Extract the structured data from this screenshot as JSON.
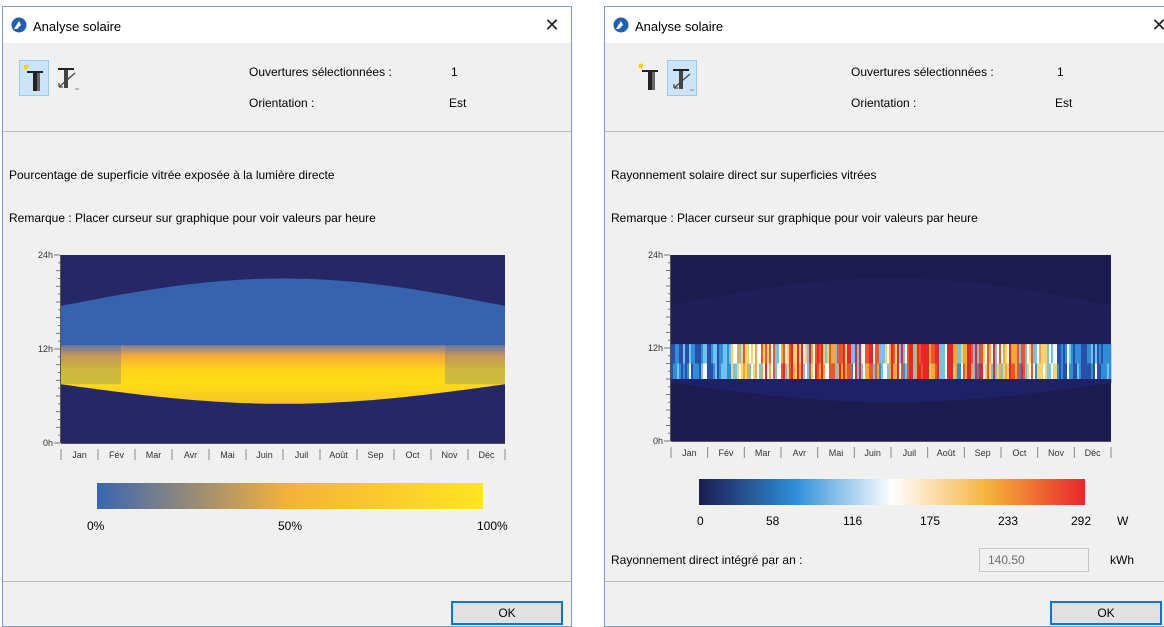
{
  "dialog_left": {
    "title": "Analyse solaire",
    "close_glyph": "✕",
    "info": {
      "openings_label": "Ouvertures sélectionnées :",
      "openings_value": "1",
      "orientation_label": "Orientation :",
      "orientation_value": "Est"
    },
    "tools": [
      {
        "icon": "shading-percentage-icon",
        "selected": true
      },
      {
        "icon": "solar-radiation-icon",
        "selected": false
      }
    ],
    "heading": "Pourcentage de superficie vitrée exposée à la lumière directe",
    "remark": "Remarque : Placer curseur sur graphique pour voir valeurs par heure",
    "legend": {
      "labels": [
        "0%",
        "50%",
        "100%"
      ],
      "colors": [
        "#3a66b0",
        "#f5b23a",
        "#ffe520"
      ]
    },
    "ok_label": "OK"
  },
  "dialog_right": {
    "title": "Analyse solaire",
    "close_glyph": "✕",
    "info": {
      "openings_label": "Ouvertures sélectionnées :",
      "openings_value": "1",
      "orientation_label": "Orientation :",
      "orientation_value": "Est"
    },
    "tools": [
      {
        "icon": "shading-percentage-icon",
        "selected": false
      },
      {
        "icon": "solar-radiation-icon",
        "selected": true
      }
    ],
    "heading": "Rayonnement solaire direct sur superficies vitrées",
    "remark": "Remarque : Placer curseur sur graphique pour voir valeurs par heure",
    "legend": {
      "labels": [
        "0",
        "58",
        "116",
        "175",
        "233",
        "292"
      ],
      "unit": "W",
      "colors": [
        "#1c1b50",
        "#2e8fd8",
        "#ffffff",
        "#f5b23a",
        "#e8262a"
      ]
    },
    "annual_label": "Rayonnement direct intégré par an :",
    "annual_value": "140.50",
    "annual_unit": "kWh",
    "ok_label": "OK"
  },
  "chart_data": [
    {
      "type": "heatmap",
      "title": "Pourcentage de superficie vitrée exposée à la lumière directe",
      "x_categories": [
        "Jan",
        "Fév",
        "Mar",
        "Avr",
        "Mai",
        "Juin",
        "Juil",
        "Août",
        "Sep",
        "Oct",
        "Nov",
        "Déc"
      ],
      "y_ticks": [
        "24h",
        "12h",
        "0h"
      ],
      "y_range_hours": [
        0,
        24
      ],
      "value_range_percent": [
        0,
        100
      ],
      "bands_hours": [
        {
          "value": "night",
          "from_hours": 0,
          "to_hours": 7.5
        },
        {
          "value": "direct light",
          "from_hours": 7.5,
          "to_hours": 12.5,
          "peak_percent": 100
        },
        {
          "value": "0%",
          "from_hours": 12.5,
          "to_hours": 17.5
        }
      ]
    },
    {
      "type": "heatmap",
      "title": "Rayonnement solaire direct sur superficies vitrées",
      "x_categories": [
        "Jan",
        "Fév",
        "Mar",
        "Avr",
        "Mai",
        "Juin",
        "Juil",
        "Août",
        "Sep",
        "Oct",
        "Nov",
        "Déc"
      ],
      "y_ticks": [
        "24h",
        "12h",
        "0h"
      ],
      "y_range_hours": [
        0,
        24
      ],
      "value_range_W": [
        0,
        292
      ],
      "annual_kWh": 140.5
    }
  ]
}
